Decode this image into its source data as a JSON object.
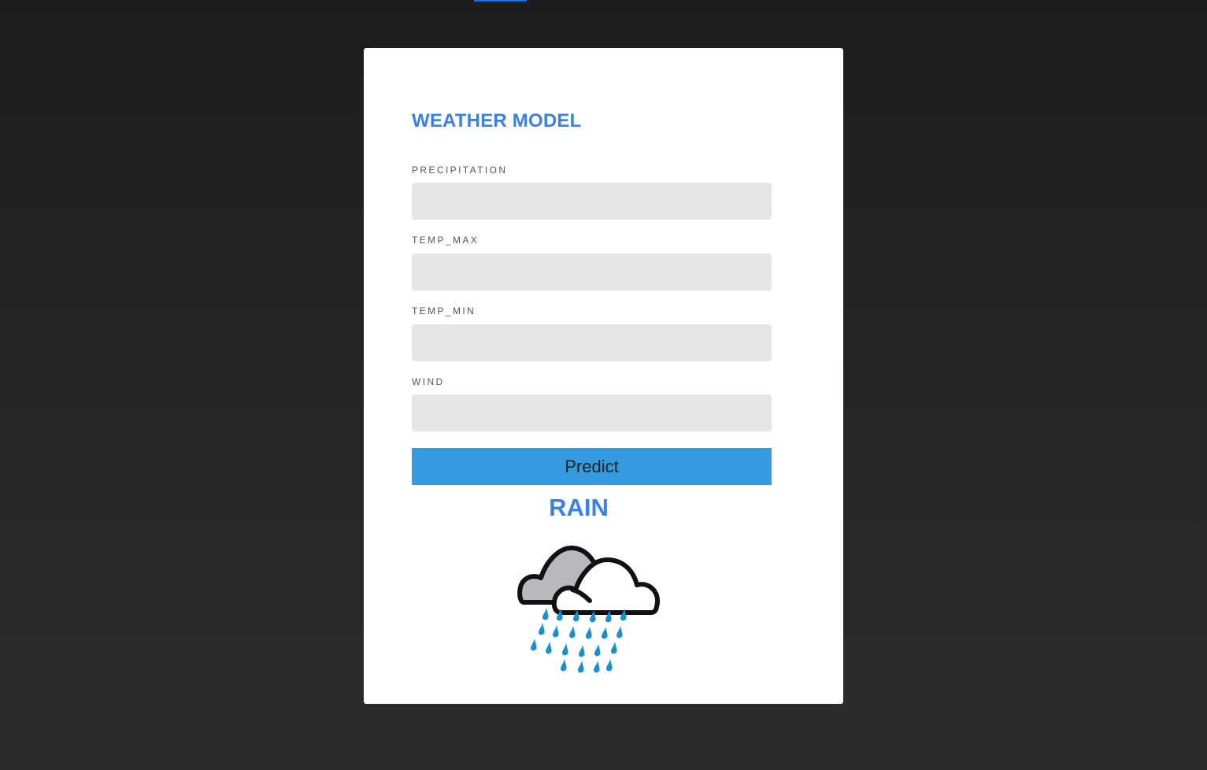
{
  "form": {
    "title": "WEATHER MODEL",
    "fields": [
      {
        "label": "PRECIPITATION",
        "value": ""
      },
      {
        "label": "TEMP_MAX",
        "value": ""
      },
      {
        "label": "TEMP_MIN",
        "value": ""
      },
      {
        "label": "WIND",
        "value": ""
      }
    ],
    "submit_label": "Predict"
  },
  "result": {
    "prediction": "RAIN",
    "icon": "rain-cloud-icon"
  },
  "colors": {
    "accent": "#3c80e4",
    "button": "#359be0",
    "input_bg": "#e5e5e5",
    "raindrop": "#1a8fd0"
  }
}
